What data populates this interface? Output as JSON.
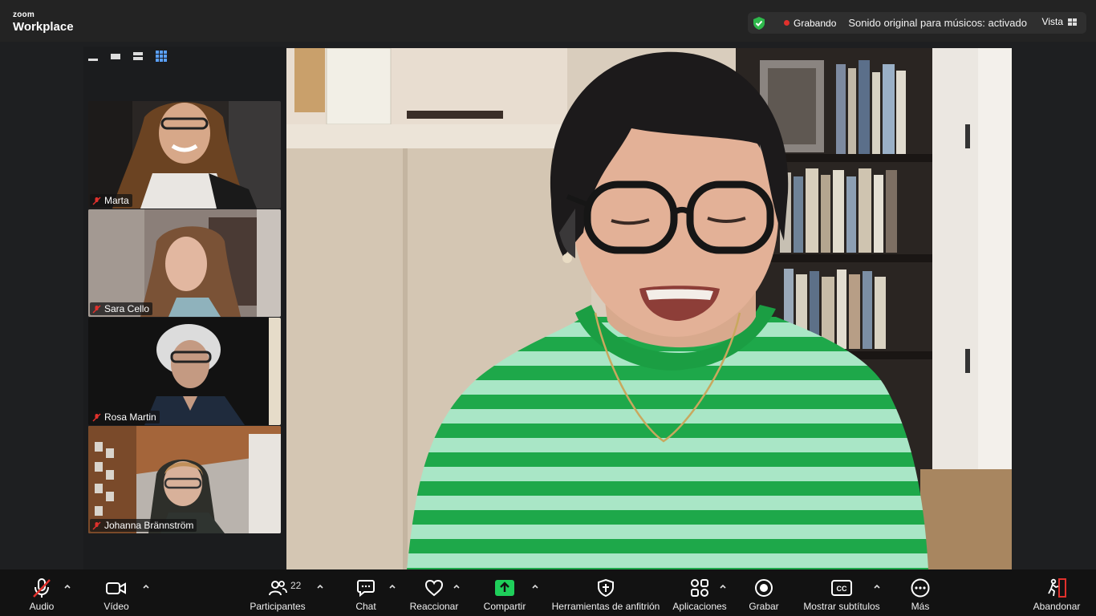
{
  "app": {
    "brand_top": "zoom",
    "brand_bottom": "Workplace"
  },
  "status": {
    "recording_label": "Grabando",
    "original_sound": "Sonido original para músicos: activado",
    "view_label": "Vista",
    "colors": {
      "shield": "#2eb84b",
      "recording": "#e0312c"
    }
  },
  "participants_panel": {
    "tiles": [
      {
        "name": "Marta",
        "muted": true
      },
      {
        "name": "Sara Cello",
        "muted": true
      },
      {
        "name": "Rosa Martin",
        "muted": true
      },
      {
        "name": "Johanna Brännström",
        "muted": true
      }
    ]
  },
  "toolbar": {
    "audio": "Audio",
    "video": "Vídeo",
    "participants": "Participantes",
    "participants_count": "22",
    "chat": "Chat",
    "react": "Reaccionar",
    "share": "Compartir",
    "host_tools": "Herramientas de anfitrión",
    "apps": "Aplicaciones",
    "record": "Grabar",
    "captions": "Mostrar subtítulos",
    "captions_icon_text": "CC",
    "more": "Más",
    "leave": "Abandonar",
    "colors": {
      "share": "#1fcf5a",
      "leave": "#e0312c",
      "muted": "#e0312c"
    }
  }
}
